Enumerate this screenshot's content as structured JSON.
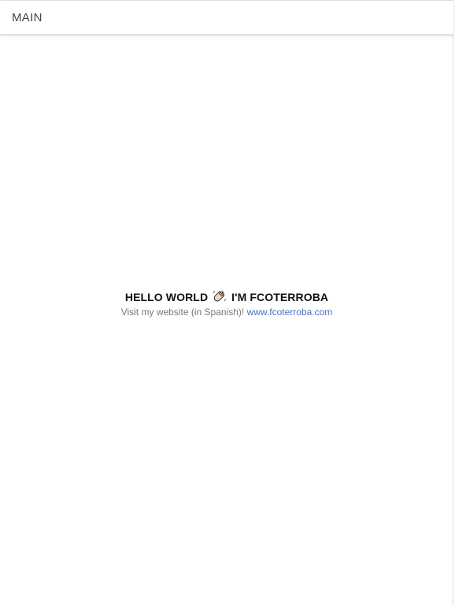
{
  "header": {
    "title": "MAIN"
  },
  "hero": {
    "greeting": "HELLO WORLD",
    "emoji_icon": "waving-hand-icon",
    "name": "I'M FCOTERROBA",
    "visit_text": "Visit my website (in Spanish)!",
    "link_text": "www.fcoterroba.com"
  },
  "colors": {
    "link": "#4a6fc0",
    "headline": "#111111",
    "subtext": "#777777"
  }
}
